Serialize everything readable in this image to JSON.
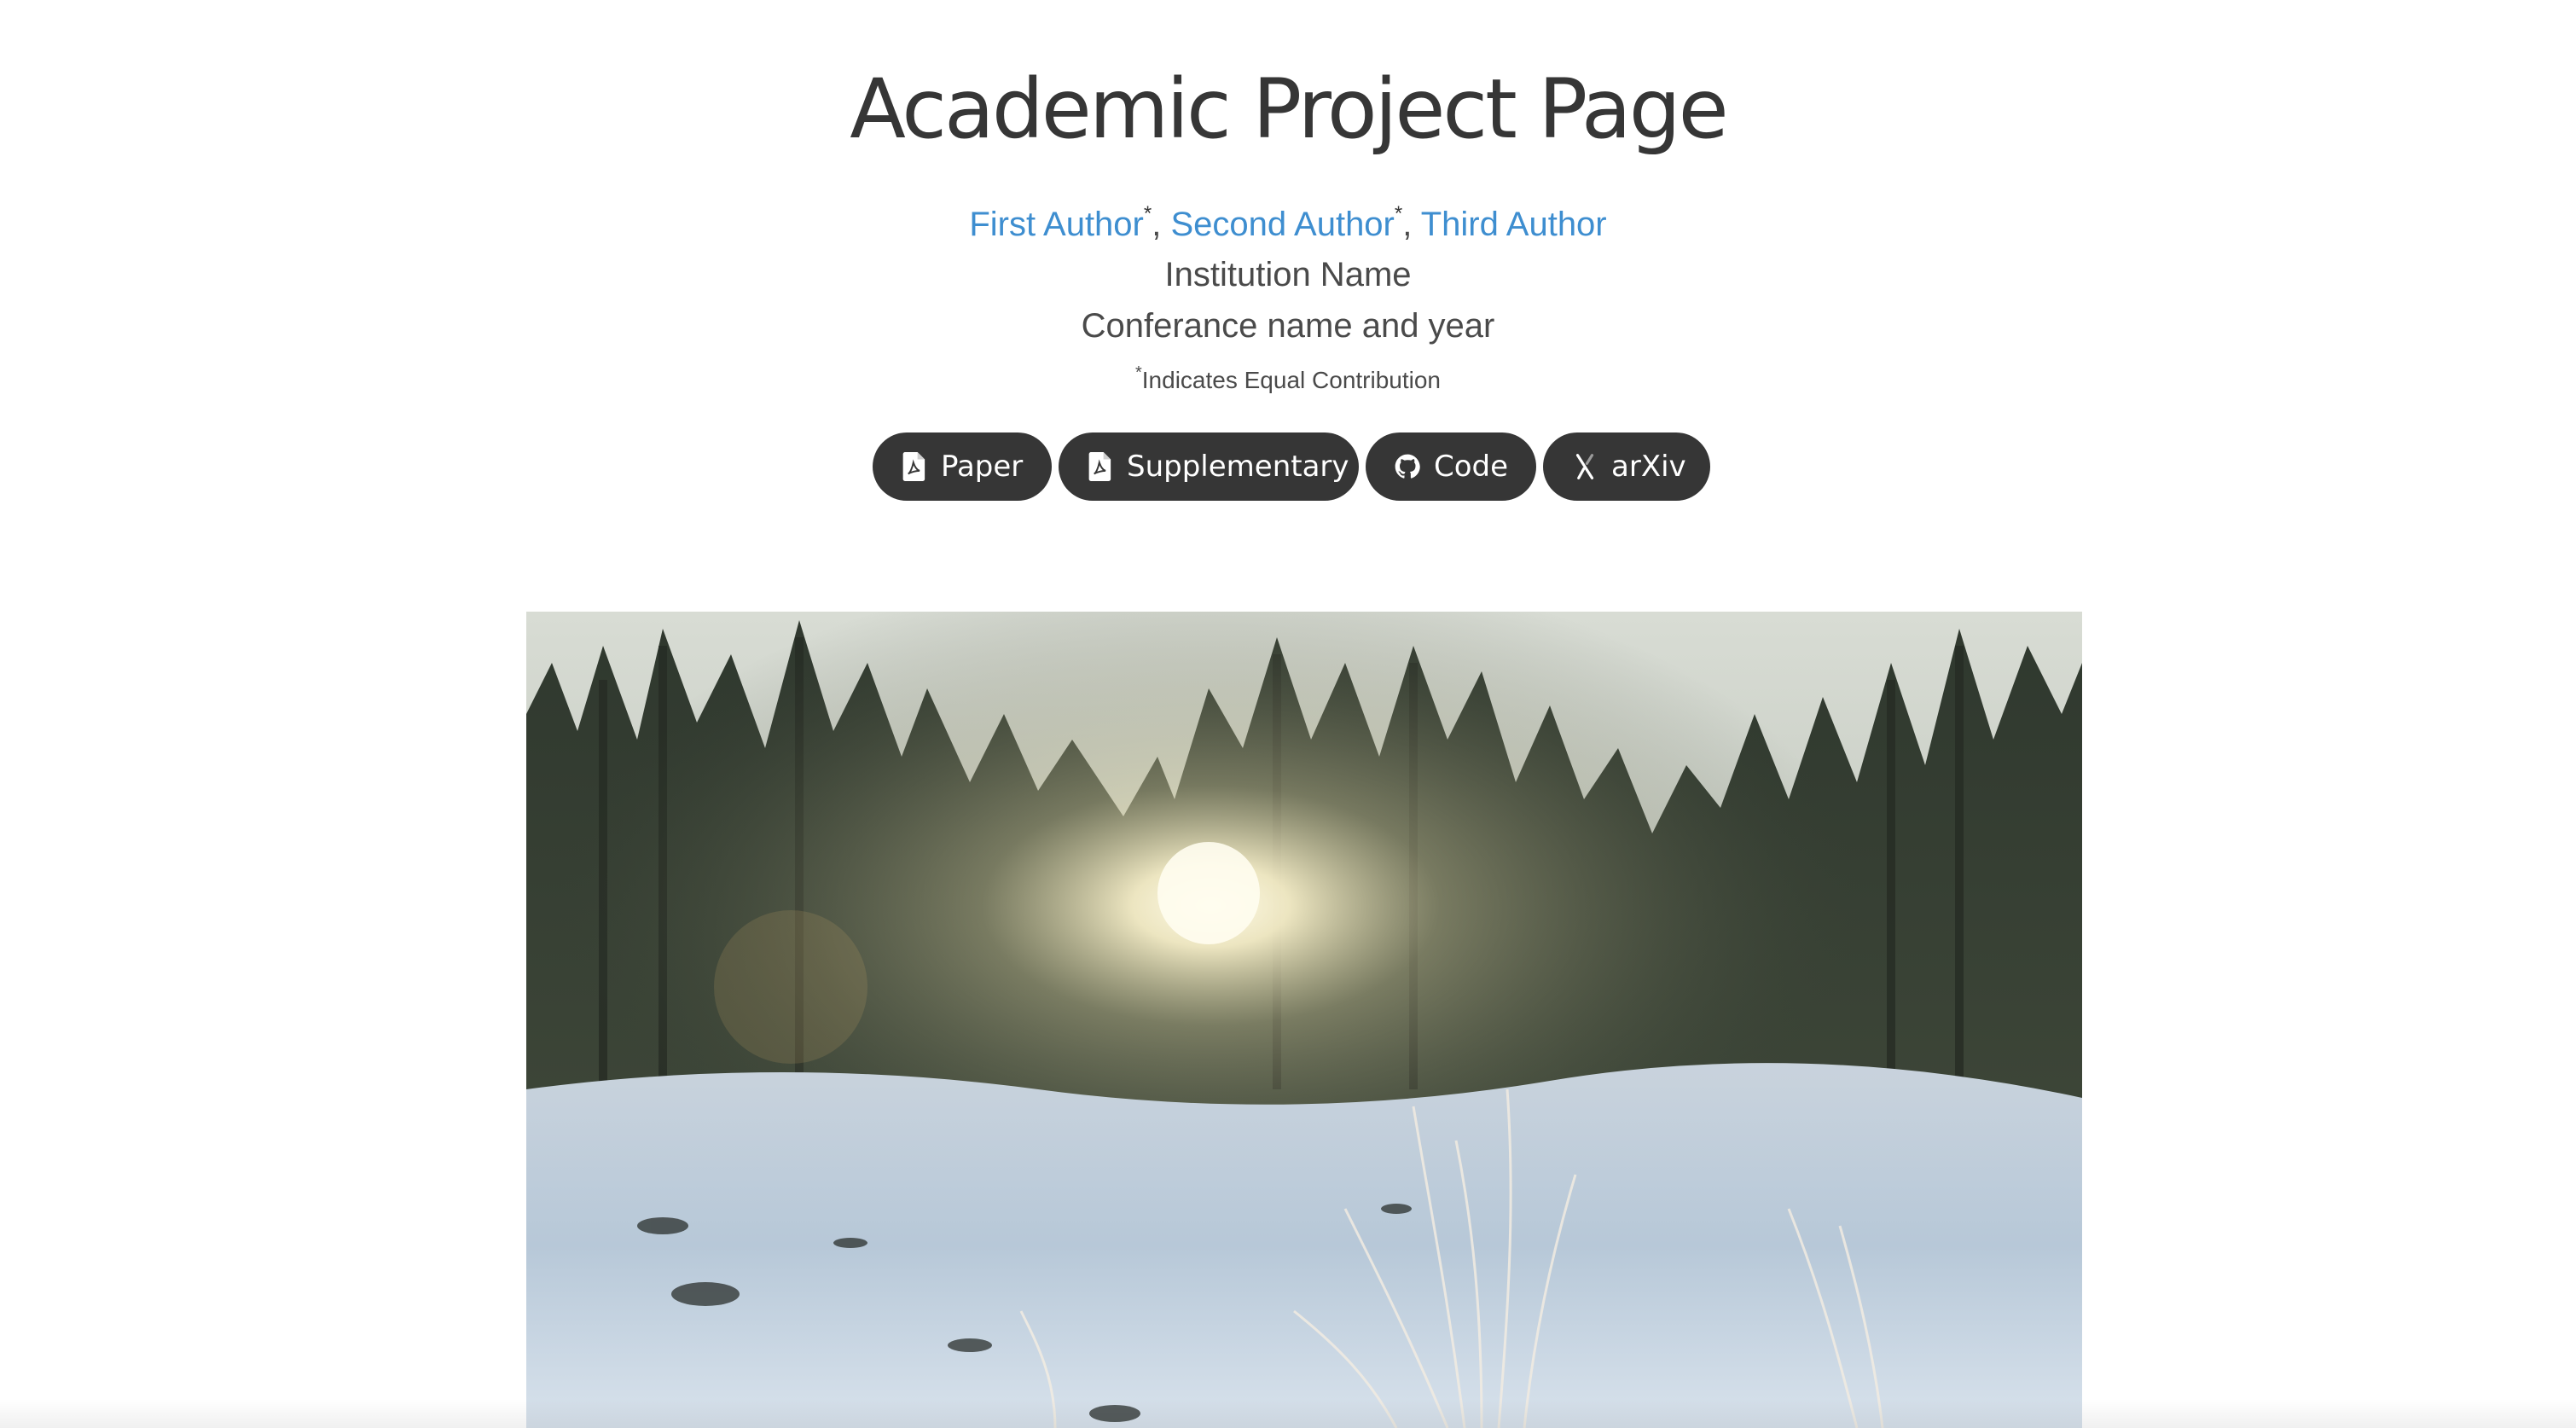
{
  "hero": {
    "title": "Academic Project Page",
    "authors": [
      {
        "name": "First Author",
        "mark": "*"
      },
      {
        "name": "Second Author",
        "mark": "*"
      },
      {
        "name": "Third Author",
        "mark": ""
      }
    ],
    "separator": ", ",
    "institution": "Institution Name",
    "conference": "Conferance name and year",
    "equal_mark": "*",
    "equal_note": "Indicates Equal Contribution"
  },
  "links": {
    "paper": {
      "label": "Paper",
      "icon": "file-pdf-icon"
    },
    "supplementary": {
      "label": "Supplementary",
      "icon": "file-pdf-icon"
    },
    "code": {
      "label": "Code",
      "icon": "github-icon"
    },
    "arxiv": {
      "label": "arXiv",
      "icon": "arxiv-icon"
    }
  },
  "colors": {
    "link": "#3e8ed0",
    "button": "#363636",
    "text": "#363636"
  },
  "media": {
    "teaser": "snowy-forest-sunrise-video"
  }
}
